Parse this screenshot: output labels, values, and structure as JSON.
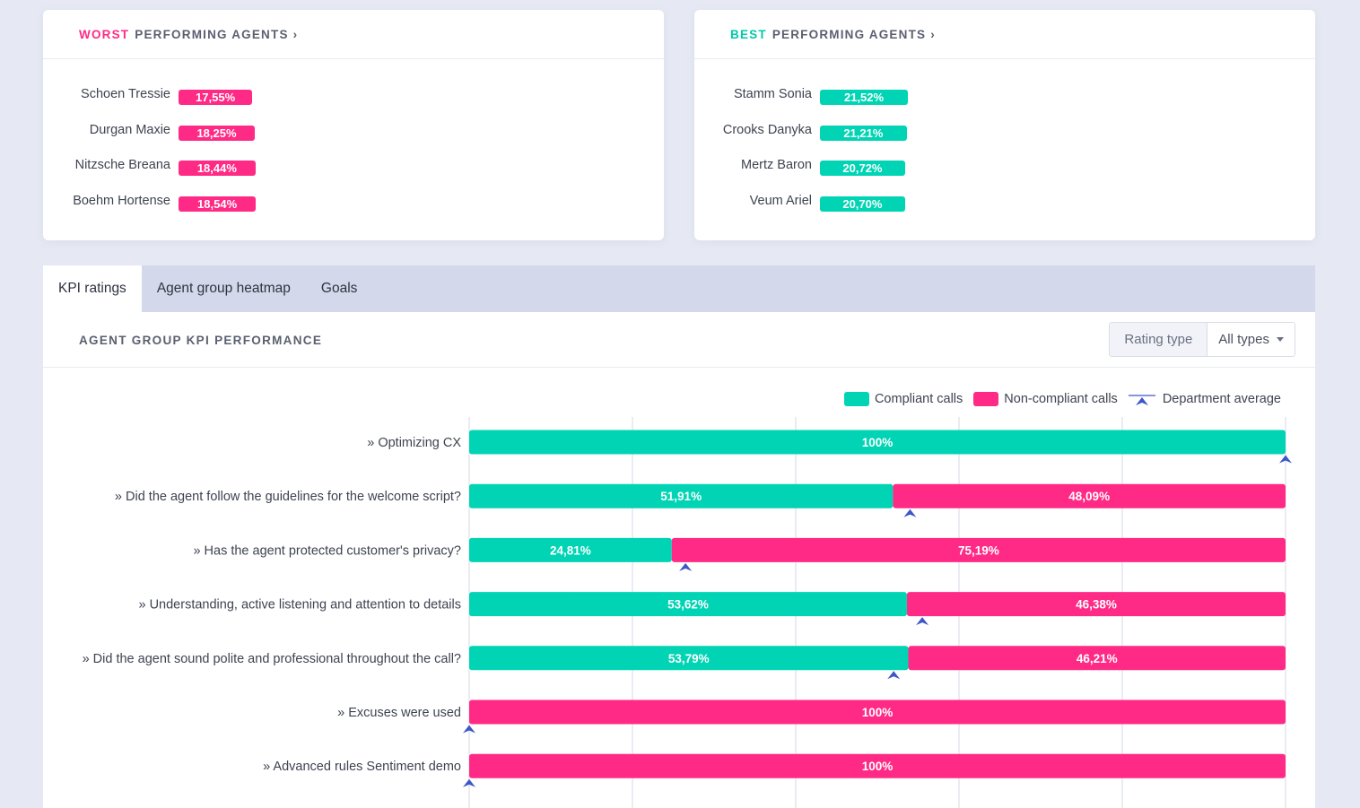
{
  "worst": {
    "accent_word": "WORST",
    "title_rest": "PERFORMING AGENTS",
    "chevron": "›",
    "agents": [
      {
        "name": "Schoen Tressie",
        "value": "17,55%"
      },
      {
        "name": "Durgan Maxie",
        "value": "18,25%"
      },
      {
        "name": "Nitzsche Breana",
        "value": "18,44%"
      },
      {
        "name": "Boehm Hortense",
        "value": "18,54%"
      }
    ]
  },
  "best": {
    "accent_word": "BEST",
    "title_rest": "PERFORMING AGENTS",
    "chevron": "›",
    "agents": [
      {
        "name": "Stamm Sonia",
        "value": "21,52%"
      },
      {
        "name": "Crooks Danyka",
        "value": "21,21%"
      },
      {
        "name": "Mertz Baron",
        "value": "20,72%"
      },
      {
        "name": "Veum Ariel",
        "value": "20,70%"
      }
    ]
  },
  "tabs": [
    {
      "label": "KPI ratings",
      "active": true
    },
    {
      "label": "Agent group heatmap",
      "active": false
    },
    {
      "label": "Goals",
      "active": false
    }
  ],
  "section": {
    "title": "AGENT GROUP KPI PERFORMANCE",
    "rating_label": "Rating type",
    "rating_value": "All types"
  },
  "colors": {
    "compliant": "#00d4b4",
    "non_compliant": "#ff2a85",
    "average_marker": "#3d56c8",
    "grid": "#dde0e8"
  },
  "chart_data": {
    "type": "bar",
    "orientation": "horizontal",
    "stacked": true,
    "xlim": [
      0,
      100
    ],
    "legend": [
      "Compliant calls",
      "Non-compliant calls",
      "Department average"
    ],
    "legend_position": "top-right",
    "categories": [
      "» Optimizing CX",
      "» Did the agent follow the guidelines for the welcome script?",
      "» Has the agent protected customer's privacy?",
      "» Understanding, active listening and attention to details",
      "» Did the agent sound polite and professional throughout the call?",
      "» Excuses were used",
      "» Advanced rules Sentiment demo"
    ],
    "series": [
      {
        "name": "Compliant calls",
        "values": [
          100,
          51.91,
          24.81,
          53.62,
          53.79,
          0,
          0
        ],
        "labels": [
          "100%",
          "51,91%",
          "24,81%",
          "53,62%",
          "53,79%",
          "",
          ""
        ]
      },
      {
        "name": "Non-compliant calls",
        "values": [
          0,
          48.09,
          75.19,
          46.38,
          46.21,
          100,
          100
        ],
        "labels": [
          "",
          "48,09%",
          "75,19%",
          "46,38%",
          "46,21%",
          "100%",
          "100%"
        ]
      }
    ],
    "department_average": [
      100,
      54,
      26.5,
      55.5,
      52,
      0,
      0
    ]
  }
}
